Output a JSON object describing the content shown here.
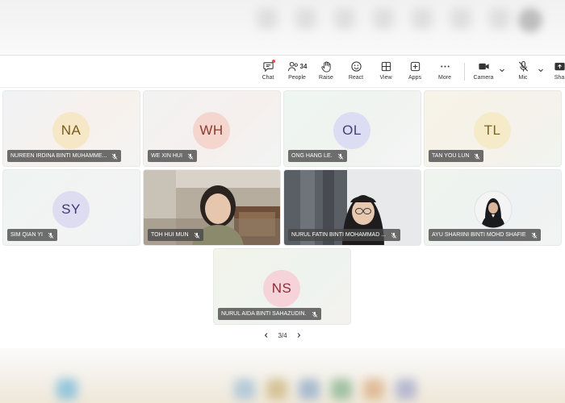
{
  "toolbar": {
    "chat_label": "Chat",
    "people_label": "People",
    "people_count": "34",
    "raise_label": "Raise",
    "react_label": "React",
    "view_label": "View",
    "apps_label": "Apps",
    "more_label": "More",
    "camera_label": "Camera",
    "mic_label": "Mic",
    "share_label": "Sha"
  },
  "participants": [
    {
      "initials": "NA",
      "name": "NUREEN IRDINA BINTI MUHAMME...",
      "avatar_bg": "#f6e7c6",
      "avatar_fg": "#7a5a1f"
    },
    {
      "initials": "WH",
      "name": "WE XIN HUI",
      "avatar_bg": "#f5d6cf",
      "avatar_fg": "#8a3b2b"
    },
    {
      "initials": "OL",
      "name": "ONG HANG LE.",
      "avatar_bg": "#dcdcf2",
      "avatar_fg": "#3f3f7a"
    },
    {
      "initials": "TL",
      "name": "TAN YOU LUN",
      "avatar_bg": "#f6ebc8",
      "avatar_fg": "#7a6420"
    },
    {
      "initials": "SY",
      "name": "SIM QIAN YI",
      "avatar_bg": "#dedcf0",
      "avatar_fg": "#3d3a73"
    },
    {
      "initials": "",
      "name": "TOH HUI MUN"
    },
    {
      "initials": "",
      "name": "NURUL FATIN BINTI MOHAMMAD ..."
    },
    {
      "initials": "",
      "name": "AYU SHARIINI BINTI MOHD SHAFIE"
    },
    {
      "initials": "NS",
      "name": "NURUL AIDA BINTI SAHAZUDIN.",
      "avatar_bg": "#f5d3d8",
      "avatar_fg": "#8a2d3b"
    }
  ],
  "pager": {
    "text": "3/4"
  },
  "colors": {
    "accent": "#5b5fc7",
    "badge_bg": "#464646",
    "notification_dot": "#d9534f"
  }
}
